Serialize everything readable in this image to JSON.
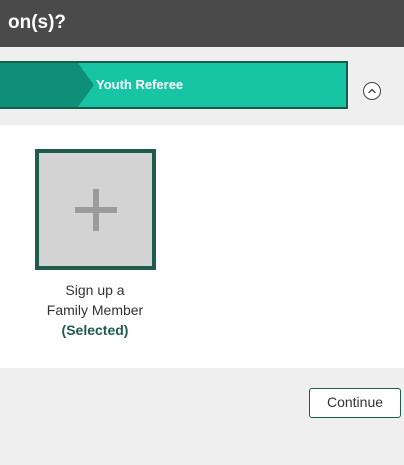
{
  "header": {
    "title": "on(s)?"
  },
  "progress": {
    "current_step_label": "Youth Referee",
    "colors": {
      "fill": "#17c4a3",
      "previous": "#0f8f78",
      "border": "#1a5c4b"
    }
  },
  "toggle": {
    "icon": "chevron-up-icon"
  },
  "cards": [
    {
      "icon": "plus-icon",
      "label_line1": "Sign up a",
      "label_line2": "Family Member",
      "status": "(Selected)"
    }
  ],
  "footer": {
    "continue_label": "Continue"
  },
  "colors": {
    "accent": "#1f5c4b",
    "header_bg": "#4a4a4a",
    "strip_bg": "#efefef"
  }
}
